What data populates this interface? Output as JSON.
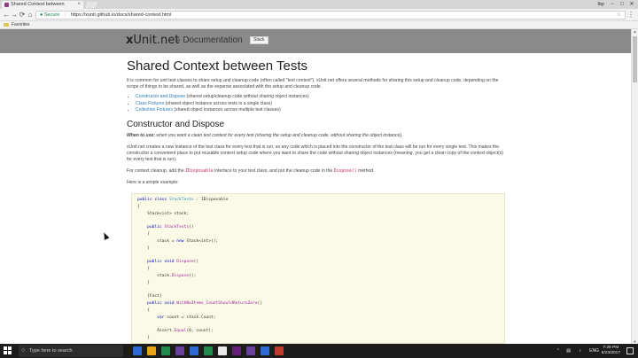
{
  "browser": {
    "tab_title": "Shared Context between",
    "tab_close": "×",
    "profile_name": "Ibp",
    "window_controls": {
      "minimize": "−",
      "maximize": "□",
      "close": "✕"
    },
    "nav": {
      "back": "←",
      "forward": "→",
      "reload": "⟳",
      "home": "⌂"
    },
    "address": {
      "secure_label": "Secure",
      "url": "https://xunit.github.io/docs/shared-context.html"
    },
    "bookmarks": {
      "folder": "Favorites"
    }
  },
  "site": {
    "brand_x": "x",
    "brand_rest": "Unit.net",
    "section": "» Documentation",
    "nav_button": "Stack"
  },
  "article": {
    "title": "Shared Context between Tests",
    "intro": "It is common for unit test classes to share setup and cleanup code (often called \"test context\"). xUnit.net offers several methods for sharing this setup and cleanup code, depending on the scope of things to be shared, as well as the expense associated with the setup and cleanup code.",
    "links": [
      {
        "link": "Constructor and Dispose",
        "desc": " (shared setup/cleanup code without sharing object instances)"
      },
      {
        "link": "Class Fixtures",
        "desc": " (shared object instance across tests in a single class)"
      },
      {
        "link": "Collection Fixtures",
        "desc": " (shared object instances across multiple test classes)"
      }
    ],
    "section_heading": "Constructor and Dispose",
    "when_to_use_label": "When to use:",
    "when_to_use_text": " when you want a clean test context for every test (sharing the setup and cleanup code, without sharing the object instance).",
    "para2": "xUnit.net creates a new instance of the test class for every test that is run, so any code which is placed into the constructor of the test class will be run for every single test. This makes the constructor a convenient place to put reusable context setup code where you want to share the code without sharing object instances (meaning, you get a clean copy of the context object(s) for every test that is run).",
    "para3_a": "For context cleanup, add the ",
    "para3_code1": "IDisposable",
    "para3_b": " interface to your test class, and put the cleanup code in the ",
    "para3_code2": "Dispose()",
    "para3_c": " method.",
    "para4": "Here is a simple example:"
  },
  "code": {
    "l1_kw": "public class ",
    "l1_ty": "StackTests",
    "l1_rest": " : IDisposable",
    "l2": "{",
    "l3": "    Stack<int> stack;",
    "l4": "",
    "l5_kw": "    public ",
    "l5_nm": "StackTests",
    "l5_rest": "()",
    "l6": "    {",
    "l7_a": "        stack = ",
    "l7_kw": "new",
    "l7_b": " Stack<int>();",
    "l8": "    }",
    "l9": "",
    "l10_kw": "    public void ",
    "l10_nm": "Dispose",
    "l10_rest": "()",
    "l11": "    {",
    "l12_a": "        stack.",
    "l12_nm": "Dispose",
    "l12_b": "();",
    "l13": "    }",
    "l14": "",
    "l15": "    [Fact]",
    "l16_kw": "    public void ",
    "l16_nm": "WithNoItems_CountShouldReturnZero",
    "l16_rest": "()",
    "l17": "    {",
    "l18_kw": "        var",
    "l18_rest": " count = stack.Count;",
    "l19": "",
    "l20_a": "        Assert.",
    "l20_nm": "Equal",
    "l20_b": "(0, count);",
    "l21": "    }"
  },
  "taskbar": {
    "search_placeholder": "Type here to search",
    "icon_colors": [
      "#2b6cd4",
      "#e8a317",
      "#1f8b4c",
      "#6b3fa0",
      "#2b6cd4",
      "#1f8b4c",
      "#e8e8e8",
      "#68217a",
      "#6b3fa0",
      "#2b6cd4",
      "#c0392b"
    ],
    "lang": "ENG",
    "time": "7:28 PM",
    "date": "8/23/2017"
  }
}
